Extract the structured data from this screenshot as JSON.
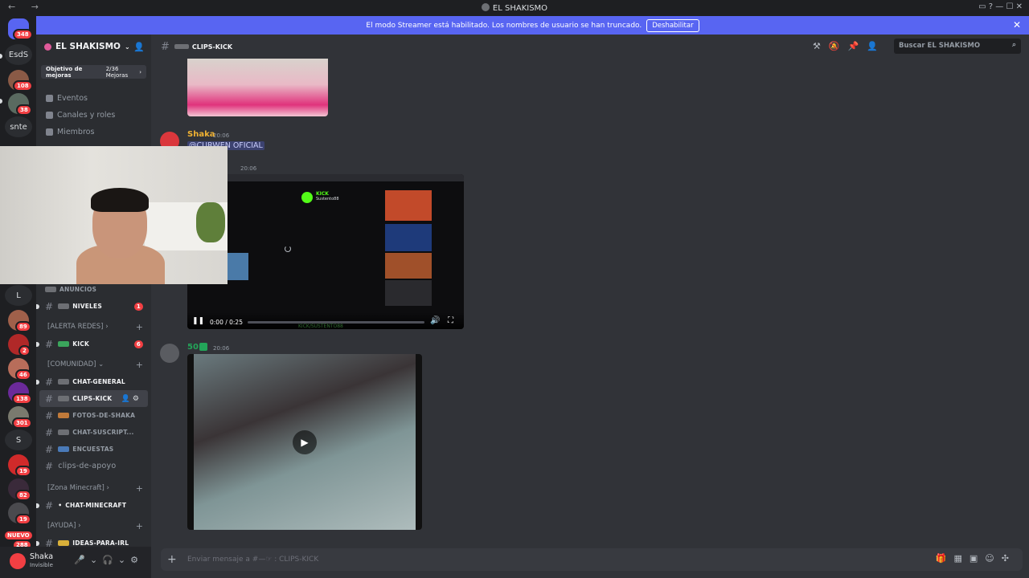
{
  "titlebar": {
    "title": "EL SHAKISMO",
    "nav": "← →",
    "controls": "▭ ? — ☐ ✕"
  },
  "banner": {
    "text": "El modo Streamer está habilitado. Los nombres de usuario se han truncado.",
    "button": "Deshabilitar",
    "close": "✕"
  },
  "servers": {
    "home_badge": "348",
    "items": [
      {
        "text": "EsdS"
      },
      {
        "badge": "108"
      },
      {
        "badge": "38"
      },
      {
        "text": "snte"
      },
      {
        "text": "L"
      },
      {
        "badge": "89"
      },
      {
        "badge": "2"
      },
      {
        "badge": "46"
      },
      {
        "badge": "138"
      },
      {
        "badge": "301"
      },
      {
        "text": "S"
      },
      {
        "badge": "19"
      },
      {
        "badge": "82"
      },
      {
        "badge": "19"
      },
      {
        "new": "NUEVO",
        "badge": "288"
      }
    ]
  },
  "sidebar": {
    "server_name": "EL SHAKISMO",
    "boost": {
      "label": "Objetivo de mejoras",
      "progress": "2/36 Mejoras"
    },
    "menu": [
      "Eventos",
      "Canales y roles",
      "Miembros"
    ],
    "channels_top": [
      {
        "name": "ANUNCIOS",
        "unread": false
      },
      {
        "name": "NIVELES",
        "unread": true,
        "count": "1"
      }
    ],
    "cat1": "[ALERTA REDES]",
    "ch_kick": {
      "name": "KICK",
      "count": "6"
    },
    "cat2": "[COMUNIDAD]",
    "community": [
      {
        "name": "CHAT-GENERAL",
        "unread": true
      },
      {
        "name": "CLIPS-KICK",
        "active": true
      },
      {
        "name": "FOTOS-DE-SHAKA"
      },
      {
        "name": "CHAT-SUSCRIPT..."
      },
      {
        "name": "ENCUESTAS"
      },
      {
        "name": "clips-de-apoyo",
        "plain": true
      }
    ],
    "cat3": "[Zona Minecraft]",
    "ch_minecraft": "CHAT-MINECRAFT",
    "cat4": "[AYUDA]",
    "ch_ideas": "IDEAS-PARA-IRL"
  },
  "user": {
    "name": "Shaka",
    "status": "Invisible"
  },
  "channel": {
    "name": "CLIPS-KICK",
    "search_placeholder": "Buscar EL SHAKISMO"
  },
  "messages": [
    {
      "author": "Shaka",
      "time": "20:06",
      "mention": "@CURWEN OFICIAL",
      "author_color": "#f0b232"
    },
    {
      "author": "",
      "time": "20:06",
      "video": {
        "overlay_title": "KICK",
        "overlay_sub": "Sustento88",
        "timecode": "0:00 / 0:25",
        "caption": "KICK/SUSTENTO88"
      }
    },
    {
      "author": "50",
      "time": "20:06",
      "author_color": "#23a559"
    }
  ],
  "composer": {
    "placeholder": "Enviar mensaje a #—☞ ꞉ CLIPS-KICK"
  }
}
